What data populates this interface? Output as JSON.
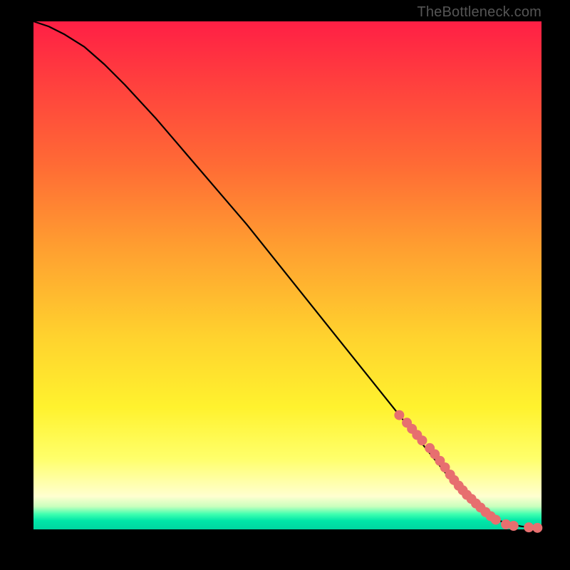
{
  "attribution": "TheBottleneck.com",
  "chart_data": {
    "type": "line",
    "title": "",
    "xlabel": "",
    "ylabel": "",
    "xlim": [
      0,
      100
    ],
    "ylim": [
      0,
      100
    ],
    "curve": {
      "x": [
        0,
        3,
        6,
        10,
        14,
        18,
        24,
        30,
        36,
        42,
        48,
        54,
        60,
        66,
        72,
        78,
        82,
        85,
        88,
        90,
        92,
        94,
        96,
        98,
        100
      ],
      "y": [
        100,
        99,
        97.5,
        95,
        91.5,
        87.5,
        81,
        74,
        67,
        60,
        52.5,
        45,
        37.5,
        30,
        22.5,
        15,
        10,
        6.5,
        4,
        2.5,
        1.6,
        1.0,
        0.6,
        0.35,
        0.25
      ]
    },
    "markers": {
      "x": [
        72,
        73.5,
        74.5,
        75.5,
        76.5,
        78,
        79,
        80,
        81,
        82,
        82.8,
        83.7,
        84.5,
        85.3,
        86.2,
        87.1,
        88,
        89,
        90,
        91,
        93,
        94.5,
        97.5,
        99.2
      ],
      "y": [
        22.5,
        21,
        19.8,
        18.6,
        17.5,
        16,
        14.8,
        13.5,
        12.2,
        10.8,
        9.7,
        8.6,
        7.7,
        6.8,
        6.0,
        5.1,
        4.3,
        3.4,
        2.6,
        1.9,
        1.0,
        0.7,
        0.4,
        0.3
      ],
      "color": "#e76f6f",
      "radius_px": 7
    }
  }
}
